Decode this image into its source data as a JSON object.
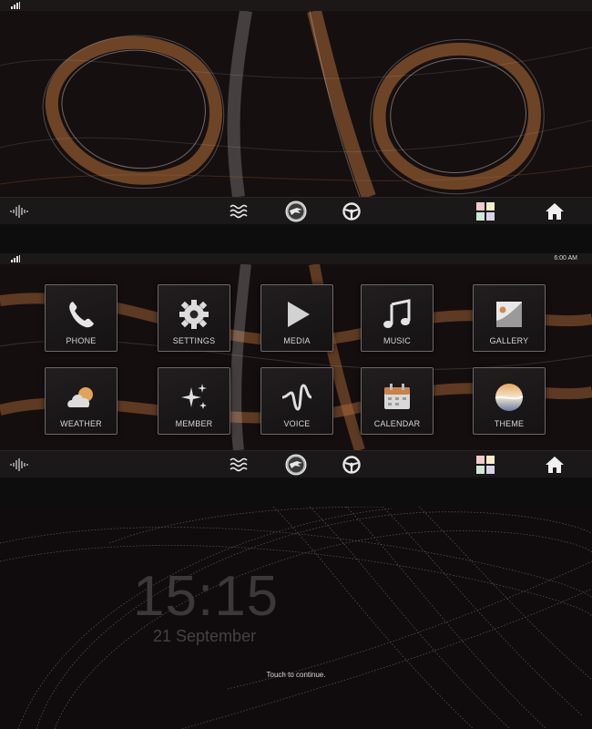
{
  "home_screen": {
    "status": {
      "signal_icon": "signal-bars-icon"
    },
    "dock": {
      "items": [
        {
          "name": "voice-wave-icon"
        },
        {
          "name": "heat-waves-icon"
        },
        {
          "name": "eagle-logo-icon"
        },
        {
          "name": "steering-wheel-icon"
        },
        {
          "name": "color-squares-icon"
        },
        {
          "name": "home-icon"
        }
      ]
    }
  },
  "apps_screen": {
    "status": {
      "time": "6:00 AM"
    },
    "apps": [
      {
        "label": "PHONE",
        "icon": "phone-icon"
      },
      {
        "label": "SETTINGS",
        "icon": "gear-icon"
      },
      {
        "label": "MEDIA",
        "icon": "play-icon"
      },
      {
        "label": "MUSIC",
        "icon": "music-note-icon"
      },
      {
        "label": "GALLERY",
        "icon": "gallery-icon"
      },
      {
        "label": "WEATHER",
        "icon": "cloud-sun-icon"
      },
      {
        "label": "MEMBER",
        "icon": "sparkle-stars-icon"
      },
      {
        "label": "VOICE",
        "icon": "voice-wave-icon"
      },
      {
        "label": "CALENDAR",
        "icon": "calendar-icon"
      },
      {
        "label": "THEME",
        "icon": "theme-orb-icon"
      }
    ]
  },
  "lock_screen": {
    "time": "15:15",
    "date": "21 September",
    "hint": "Touch to continue."
  },
  "colors": {
    "accent_copper": "#b8713b",
    "mesh_white": "#cfcaca",
    "background": "#0c0a0a"
  }
}
